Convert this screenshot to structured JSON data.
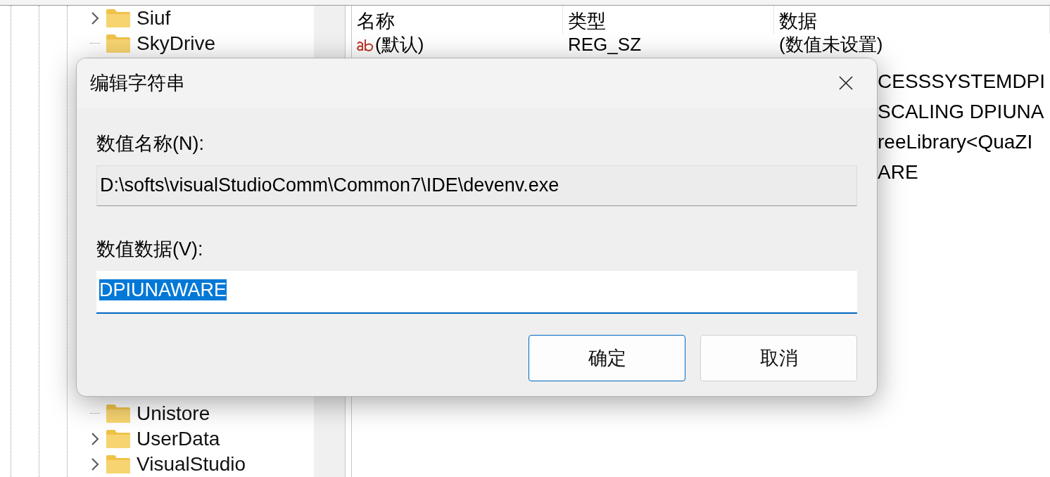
{
  "tree": {
    "top_items": [
      {
        "label": "Siuf",
        "has_children": true
      },
      {
        "label": "SkyDrive",
        "has_children": false
      }
    ],
    "bottom_items": [
      {
        "label": "Unistore",
        "has_children": false
      },
      {
        "label": "UserData",
        "has_children": true
      },
      {
        "label": "VisualStudio",
        "has_children": true
      }
    ]
  },
  "values_list": {
    "columns": [
      "名称",
      "类型",
      "数据"
    ],
    "rows": [
      {
        "name": "(默认)",
        "type": "REG_SZ",
        "data": "(数值未设置)"
      }
    ],
    "data_fragments": [
      "CESSSYSTEMDPI",
      "SCALING DPIUNA",
      "reeLibrary<QuaZI",
      "ARE"
    ]
  },
  "dialog": {
    "title": "编辑字符串",
    "name_label": "数值名称(N):",
    "name_value": "D:\\softs\\visualStudioComm\\Common7\\IDE\\devenv.exe",
    "data_label": "数值数据(V):",
    "data_value": "DPIUNAWARE",
    "data_selected": true,
    "buttons": [
      {
        "label": "确定",
        "default": true
      },
      {
        "label": "取消",
        "default": false
      }
    ]
  }
}
